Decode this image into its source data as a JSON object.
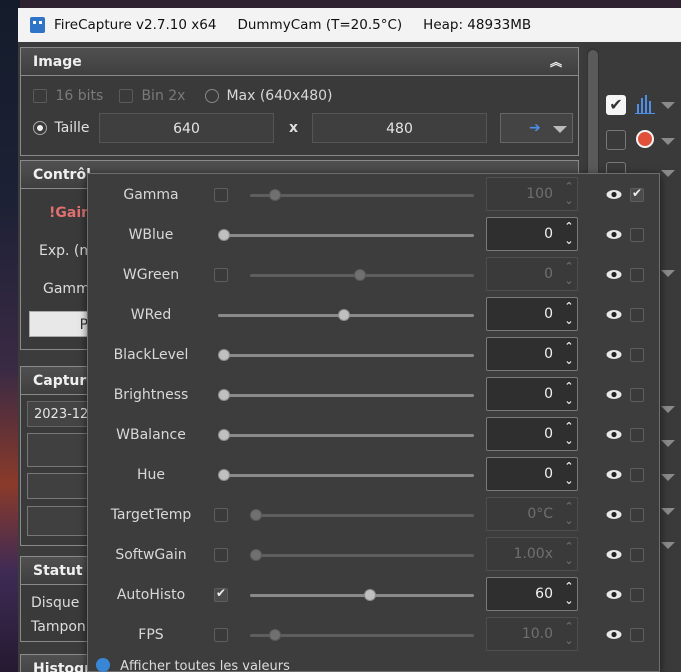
{
  "titlebar": {
    "app": "FireCapture v2.7.10 x64",
    "camera": "DummyCam (T=20.5°C)",
    "heap": "Heap: 48933MB"
  },
  "image_group": {
    "title": "Image",
    "opt_16bits": "16 bits",
    "opt_bin": "Bin 2x",
    "opt_max": "Max (640x480)",
    "size_label": "Taille",
    "width": "640",
    "x_sep": "x",
    "height": "480"
  },
  "controls_group": {
    "title": "Contrôl",
    "gain": "!Gain",
    "exp": "Exp. (m",
    "gamma": "Gamm",
    "btn": "Pl"
  },
  "capture_group": {
    "title": "Capture",
    "date": "2023-12"
  },
  "status_group": {
    "title": "Statut",
    "disk": "Disque",
    "buffer": "Tampon"
  },
  "histo_group": {
    "title": "Histogr"
  },
  "popup": {
    "rows": [
      {
        "label": "Gamma",
        "checked": false,
        "value": "100",
        "enabled": false,
        "pos": 0.09,
        "vis_checked": true
      },
      {
        "label": "WBlue",
        "checked": null,
        "value": "0",
        "enabled": true,
        "pos": 0.0,
        "vis_checked": false
      },
      {
        "label": "WGreen",
        "checked": false,
        "value": "0",
        "enabled": false,
        "pos": 0.49,
        "vis_checked": false
      },
      {
        "label": "WRed",
        "checked": null,
        "value": "0",
        "enabled": true,
        "pos": 0.49,
        "vis_checked": false
      },
      {
        "label": "BlackLevel",
        "checked": null,
        "value": "0",
        "enabled": true,
        "pos": 0.0,
        "vis_checked": false
      },
      {
        "label": "Brightness",
        "checked": null,
        "value": "0",
        "enabled": true,
        "pos": 0.0,
        "vis_checked": false
      },
      {
        "label": "WBalance",
        "checked": null,
        "value": "0",
        "enabled": true,
        "pos": 0.0,
        "vis_checked": false
      },
      {
        "label": "Hue",
        "checked": null,
        "value": "0",
        "enabled": true,
        "pos": 0.0,
        "vis_checked": false
      },
      {
        "label": "TargetTemp",
        "checked": false,
        "value": "0°C",
        "enabled": false,
        "pos": 0.0,
        "vis_checked": false
      },
      {
        "label": "SoftwGain",
        "checked": false,
        "value": "1.00x",
        "enabled": false,
        "pos": 0.0,
        "vis_checked": false
      },
      {
        "label": "AutoHisto",
        "checked": true,
        "value": "60",
        "enabled": true,
        "pos": 0.54,
        "vis_checked": false
      },
      {
        "label": "FPS",
        "checked": false,
        "value": "10.0",
        "enabled": false,
        "pos": 0.09,
        "vis_checked": false
      }
    ],
    "footer": "Afficher toutes les valeurs"
  },
  "colors": {
    "accent": "#2f74c6",
    "gain_label": "#e07070"
  },
  "icons": [
    "app-icon",
    "chevron-up-icon",
    "arrow-right-icon",
    "histogram-icon",
    "crosshair-icon",
    "eye-icon",
    "gear-icon"
  ]
}
